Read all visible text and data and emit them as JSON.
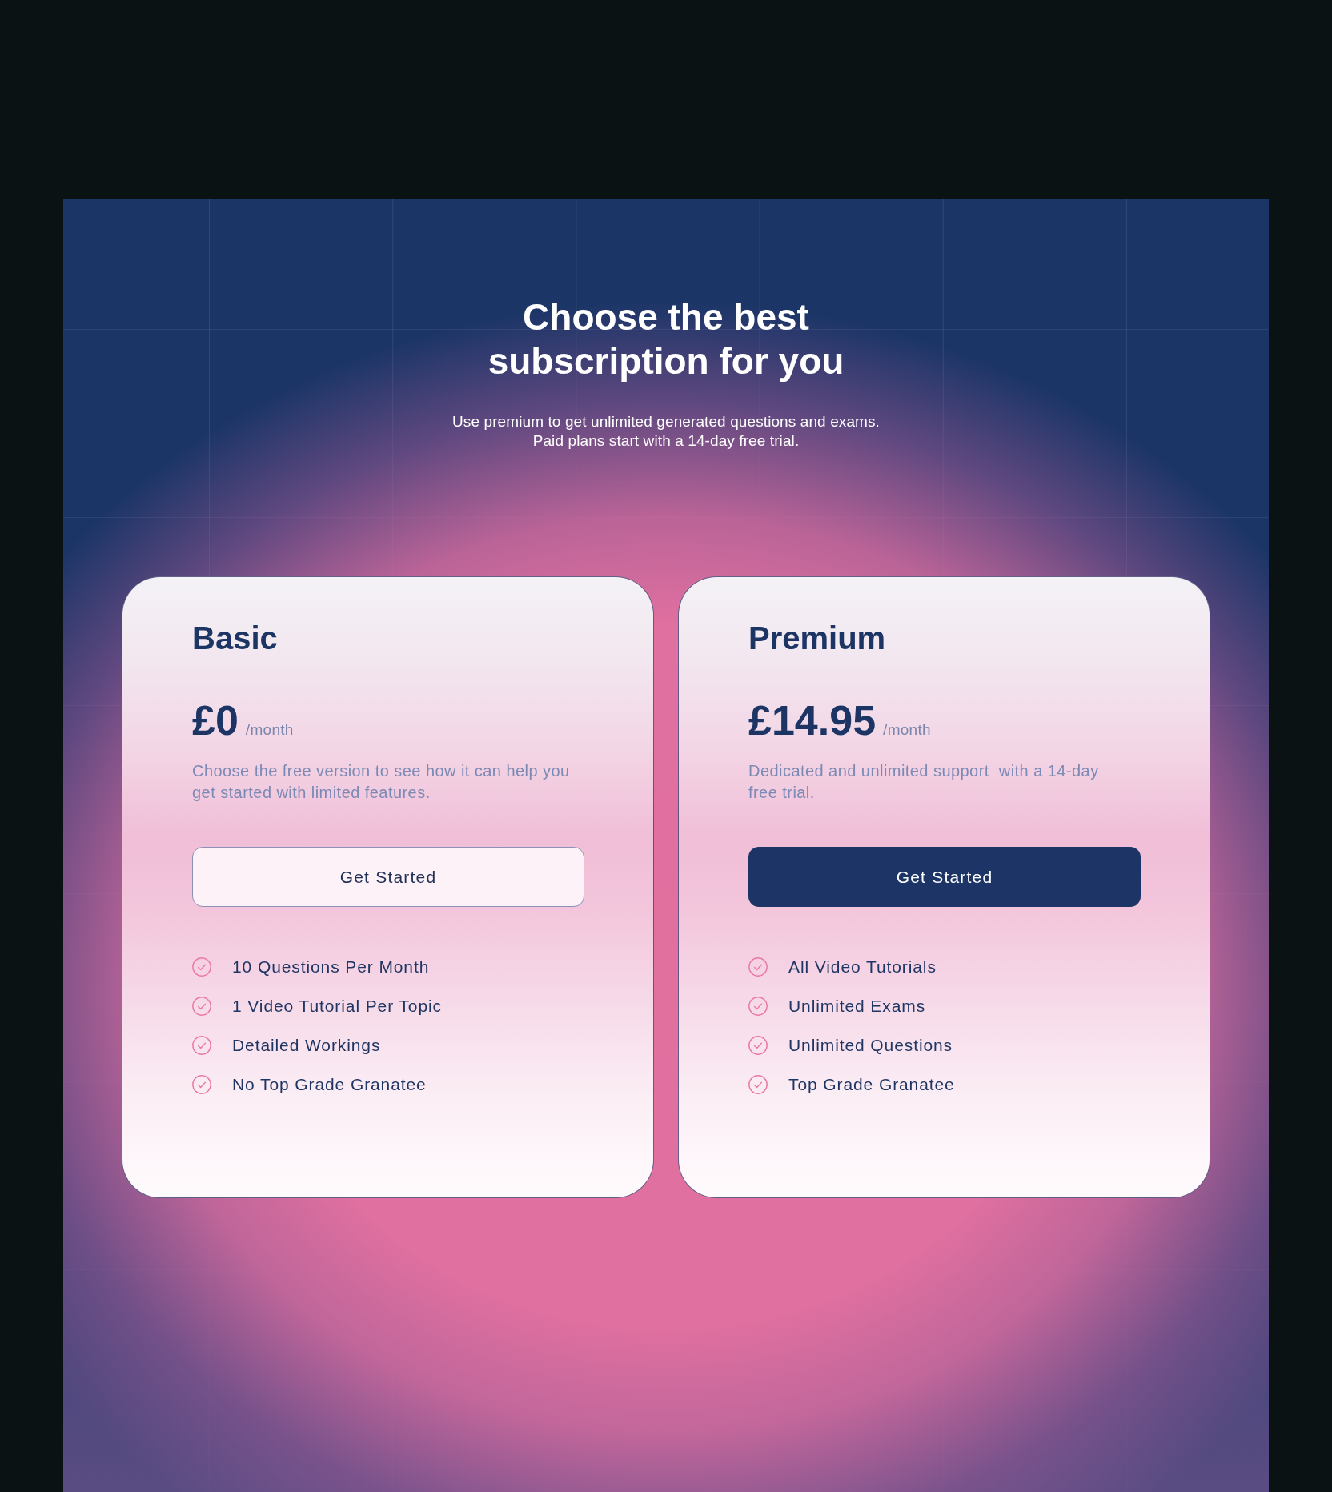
{
  "header": {
    "title": "Choose the best subscription for you",
    "subtitle": "Use premium to get unlimited generated questions and exams. Paid plans start with a 14-day free trial."
  },
  "plans": [
    {
      "name": "Basic",
      "price": "£0",
      "period": "/month",
      "description": "Choose the free version to see how it can help you get started with limited features.",
      "button": {
        "label": "Get Started",
        "kind": "outline"
      },
      "features": [
        "10 Questions Per Month",
        "1 Video Tutorial Per Topic",
        "Detailed Workings",
        "No Top Grade Granatee"
      ]
    },
    {
      "name": "Premium",
      "price": "£14.95",
      "period": "/month",
      "description": "Dedicated and unlimited support  with a 14-day free trial.",
      "button": {
        "label": "Get Started",
        "kind": "filled"
      },
      "features": [
        "All Video Tutorials",
        "Unlimited Exams",
        "Unlimited Questions",
        "Top Grade Granatee"
      ]
    }
  ]
}
